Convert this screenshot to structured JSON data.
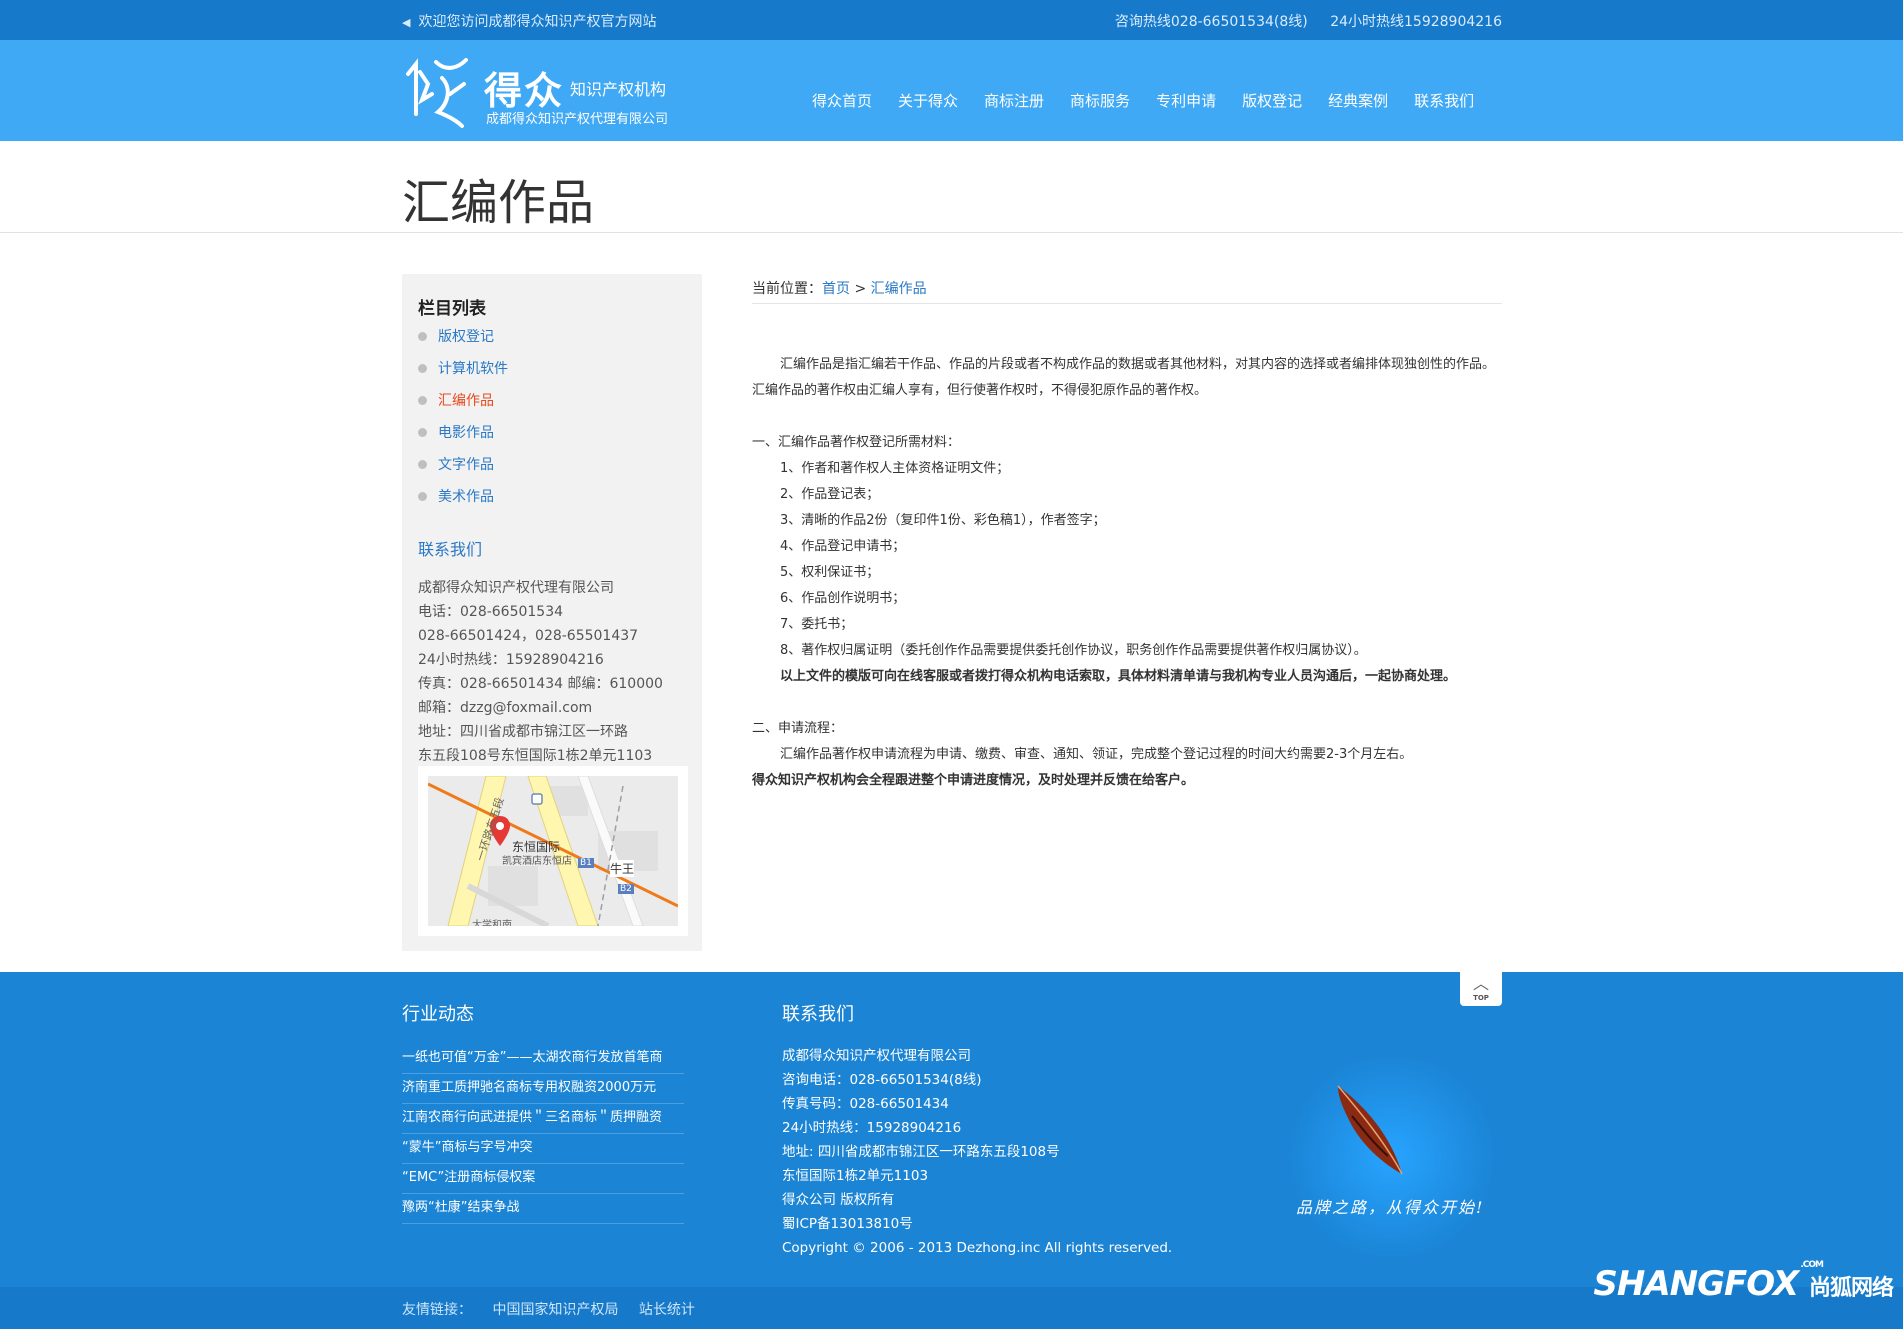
{
  "topbar": {
    "welcome": "欢迎您访问成都得众知识产权官方网站",
    "hotline1": "咨询热线028-66501534(8线)",
    "hotline2": "24小时热线15928904216"
  },
  "logo": {
    "brand": "得众",
    "brand_sub": "知识产权机构",
    "company": "成都得众知识产权代理有限公司"
  },
  "nav": [
    "得众首页",
    "关于得众",
    "商标注册",
    "商标服务",
    "专利申请",
    "版权登记",
    "经典案例",
    "联系我们"
  ],
  "page_title": "汇编作品",
  "sidebar": {
    "title": "栏目列表",
    "items": [
      "版权登记",
      "计算机软件",
      "汇编作品",
      "电影作品",
      "文字作品",
      "美术作品"
    ],
    "active_index": 2,
    "contact_title": "联系我们",
    "contact_lines": [
      "成都得众知识产权代理有限公司",
      "电话：028-66501534",
      "028-66501424，028-65501437",
      "24小时热线：15928904216",
      "传真：028-66501434 邮编：610000",
      "邮箱：dzzg@foxmail.com",
      "地址：四川省成都市锦江区一环路",
      "东五段108号东恒国际1栋2单元1103"
    ],
    "map": {
      "road_label": "一环路东五段",
      "poi": "东恒国际",
      "poi2": "凯宾酒店东恒店",
      "station": "牛王",
      "b1": "B1",
      "b2": "B2",
      "street_cut": "大学和南"
    }
  },
  "breadcrumb": {
    "prefix": "当前位置：",
    "home": "首页",
    "sep": ">",
    "current": "汇编作品"
  },
  "content": {
    "intro1": "汇编作品是指汇编若干作品、作品的片段或者不构成作品的数据或者其他材料，对其内容的选择或者编排体现独创性的作品。",
    "intro2": "汇编作品的著作权由汇编人享有，但行使著作权时，不得侵犯原作品的著作权。",
    "sec1_title": "一、汇编作品著作权登记所需材料：",
    "sec1_items": [
      "1、作者和著作权人主体资格证明文件；",
      "2、作品登记表；",
      "3、清晰的作品2份（复印件1份、彩色稿1），作者签字；",
      "4、作品登记申请书；",
      "5、权利保证书；",
      "6、作品创作说明书；",
      "7、委托书；",
      "8、著作权归属证明（委托创作作品需要提供委托创作协议，职务创作作品需要提供著作权归属协议）。"
    ],
    "sec1_note": "以上文件的模版可向在线客服或者拨打得众机构电话索取，具体材料清单请与我机构专业人员沟通后，一起协商处理。",
    "sec2_title": "二、申请流程：",
    "sec2_text": "汇编作品著作权申请流程为申请、缴费、审查、通知、领证，完成整个登记过程的时间大约需要2-3个月左右。",
    "sec2_note": "得众知识产权机构会全程跟进整个申请进度情况，及时处理并反馈在给客户。"
  },
  "footer": {
    "news_title": "行业动态",
    "news": [
      "一纸也可值“万金”——太湖农商行发放首笔商",
      "济南重工质押驰名商标专用权融资2000万元",
      "江南农商行向武进提供＂三名商标＂质押融资",
      "“蒙牛”商标与字号冲突",
      "“EMC”注册商标侵权案",
      "豫两“杜康”结束争战"
    ],
    "contact_title": "联系我们",
    "contact_lines": [
      "成都得众知识产权代理有限公司",
      "咨询电话：028-66501534(8线)",
      "传真号码：028-66501434",
      "24小时热线：15928904216",
      "地址: 四川省成都市锦江区一环路东五段108号",
      "东恒国际1栋2单元1103",
      "得众公司 版权所有",
      "蜀ICP备13013810号",
      "Copyright © 2006 - 2013 Dezhong.inc All rights reserved."
    ],
    "top_label": "TOP",
    "slogan": "品牌之路，从得众开始!",
    "friend_label": "友情链接：",
    "friend_links": [
      "中国国家知识产权局",
      "站长统计"
    ]
  },
  "watermark": {
    "text": "SHANGFOX",
    "com": ".COM",
    "cn": "尚狐网络"
  }
}
